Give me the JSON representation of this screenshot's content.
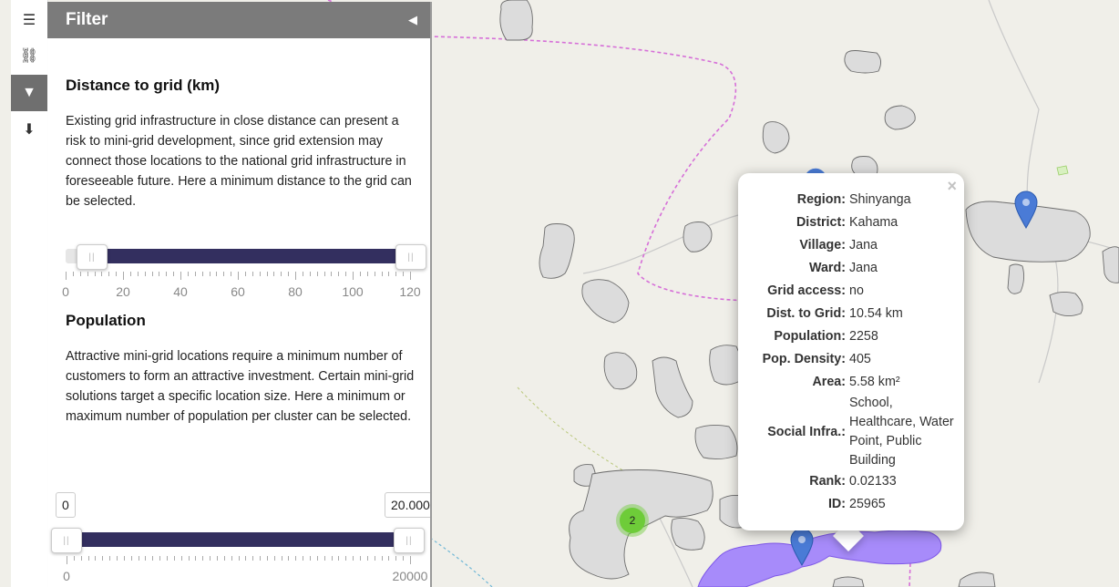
{
  "sidebar": {
    "tabs": [
      {
        "name": "menu-icon",
        "glyph": "☰"
      },
      {
        "name": "link-icon",
        "glyph": "⛓"
      },
      {
        "name": "filter-icon",
        "glyph": "▼"
      },
      {
        "name": "download-icon",
        "glyph": "⬇"
      }
    ]
  },
  "panel": {
    "title": "Filter",
    "collapse_glyph": "◀",
    "distance": {
      "title": "Distance to grid (km)",
      "description": "Existing grid infrastructure in close distance can present a risk to mini-grid development, since grid extension may connect those locations to the national grid infrastructure in foreseeable future. Here a minimum distance to the grid can be selected.",
      "ticks": [
        "0",
        "20",
        "40",
        "60",
        "80",
        "100",
        "120"
      ],
      "range_min": 0,
      "range_max": 120,
      "selected_min": 8,
      "selected_max": 120
    },
    "population": {
      "title": "Population",
      "description": "Attractive mini-grid locations require a minimum number of customers to form an attractive investment. Certain mini-grid solutions target a specific location size. Here a minimum or maximum number of population per cluster can be selected.",
      "min_input": "0",
      "max_input": "20.000",
      "tick_min": "0",
      "tick_max": "20000",
      "range_min": 0,
      "range_max": 20000,
      "selected_min": 0,
      "selected_max": 20000
    }
  },
  "popup": {
    "close": "×",
    "rows": [
      {
        "key": "Region",
        "value": "Shinyanga"
      },
      {
        "key": "District",
        "value": "Kahama"
      },
      {
        "key": "Village",
        "value": "Jana"
      },
      {
        "key": "Ward",
        "value": "Jana"
      },
      {
        "key": "Grid access",
        "value": "no"
      },
      {
        "key": "Dist. to Grid",
        "value": "10.54 km"
      },
      {
        "key": "Population",
        "value": "2258"
      },
      {
        "key": "Pop. Density",
        "value": "405"
      },
      {
        "key": "Area",
        "value": "5.58 km²"
      },
      {
        "key": "Social Infra.",
        "value": "School, Healthcare, Water Point, Public Building"
      },
      {
        "key": "Rank",
        "value": "0.02133"
      },
      {
        "key": "ID",
        "value": "25965"
      }
    ]
  },
  "map": {
    "cluster_count": "2",
    "colors": {
      "background": "#f0efe9",
      "settlement": "#dcdcdc",
      "selected_cluster": "#a78bfa",
      "boundary": "#d66fd8",
      "marker": "#4a7bd6",
      "slider": "#332f5f"
    }
  }
}
